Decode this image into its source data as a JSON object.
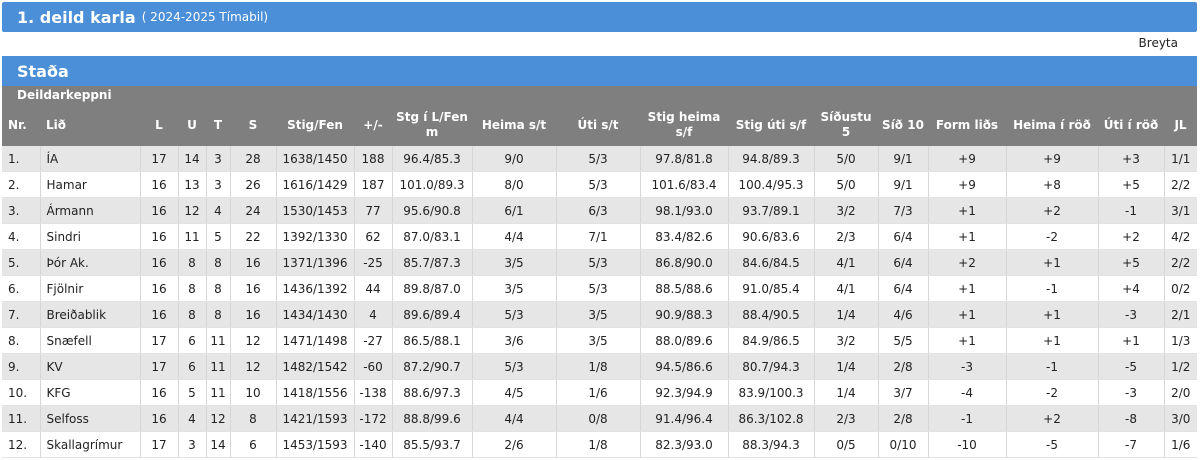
{
  "header": {
    "title": "1. deild karla",
    "subtitle": "( 2024-2025 Tímabil)"
  },
  "edit_label": "Breyta",
  "section_title": "Staða",
  "subheader": "Deildarkeppni",
  "columns": [
    "Nr.",
    "Lið",
    "L",
    "U",
    "T",
    "S",
    "Stig/Fen",
    "+/-",
    "Stg í L/Fen m",
    "Heima s/t",
    "Úti s/t",
    "Stig heima s/f",
    "Stig úti s/f",
    "Síðustu 5",
    "Síð 10",
    "Form liðs",
    "Heima í röð",
    "Úti í röð",
    "JL"
  ],
  "rows": [
    [
      "1.",
      "ÍA",
      "17",
      "14",
      "3",
      "28",
      "1638/1450",
      "188",
      "96.4/85.3",
      "9/0",
      "5/3",
      "97.8/81.8",
      "94.8/89.3",
      "5/0",
      "9/1",
      "+9",
      "+9",
      "+3",
      "1/1"
    ],
    [
      "2.",
      "Hamar",
      "16",
      "13",
      "3",
      "26",
      "1616/1429",
      "187",
      "101.0/89.3",
      "8/0",
      "5/3",
      "101.6/83.4",
      "100.4/95.3",
      "5/0",
      "9/1",
      "+9",
      "+8",
      "+5",
      "2/2"
    ],
    [
      "3.",
      "Ármann",
      "16",
      "12",
      "4",
      "24",
      "1530/1453",
      "77",
      "95.6/90.8",
      "6/1",
      "6/3",
      "98.1/93.0",
      "93.7/89.1",
      "3/2",
      "7/3",
      "+1",
      "+2",
      "-1",
      "3/1"
    ],
    [
      "4.",
      "Sindri",
      "16",
      "11",
      "5",
      "22",
      "1392/1330",
      "62",
      "87.0/83.1",
      "4/4",
      "7/1",
      "83.4/82.6",
      "90.6/83.6",
      "2/3",
      "6/4",
      "+1",
      "-2",
      "+2",
      "4/2"
    ],
    [
      "5.",
      "Þór Ak.",
      "16",
      "8",
      "8",
      "16",
      "1371/1396",
      "-25",
      "85.7/87.3",
      "3/5",
      "5/3",
      "86.8/90.0",
      "84.6/84.5",
      "4/1",
      "6/4",
      "+2",
      "+1",
      "+5",
      "2/2"
    ],
    [
      "6.",
      "Fjölnir",
      "16",
      "8",
      "8",
      "16",
      "1436/1392",
      "44",
      "89.8/87.0",
      "3/5",
      "5/3",
      "88.5/88.6",
      "91.0/85.4",
      "4/1",
      "6/4",
      "+1",
      "-1",
      "+4",
      "0/2"
    ],
    [
      "7.",
      "Breiðablik",
      "16",
      "8",
      "8",
      "16",
      "1434/1430",
      "4",
      "89.6/89.4",
      "5/3",
      "3/5",
      "90.9/88.3",
      "88.4/90.5",
      "1/4",
      "4/6",
      "+1",
      "+1",
      "-3",
      "2/1"
    ],
    [
      "8.",
      "Snæfell",
      "17",
      "6",
      "11",
      "12",
      "1471/1498",
      "-27",
      "86.5/88.1",
      "3/6",
      "3/5",
      "88.0/89.6",
      "84.9/86.5",
      "3/2",
      "5/5",
      "+1",
      "+1",
      "+1",
      "1/3"
    ],
    [
      "9.",
      "KV",
      "17",
      "6",
      "11",
      "12",
      "1482/1542",
      "-60",
      "87.2/90.7",
      "5/3",
      "1/8",
      "94.5/86.6",
      "80.7/94.3",
      "1/4",
      "2/8",
      "-3",
      "-1",
      "-5",
      "1/2"
    ],
    [
      "10.",
      "KFG",
      "16",
      "5",
      "11",
      "10",
      "1418/1556",
      "-138",
      "88.6/97.3",
      "4/5",
      "1/6",
      "92.3/94.9",
      "83.9/100.3",
      "1/4",
      "3/7",
      "-4",
      "-2",
      "-3",
      "2/0"
    ],
    [
      "11.",
      "Selfoss",
      "16",
      "4",
      "12",
      "8",
      "1421/1593",
      "-172",
      "88.8/99.6",
      "4/4",
      "0/8",
      "91.4/96.4",
      "86.3/102.8",
      "2/3",
      "2/8",
      "-1",
      "+2",
      "-8",
      "3/0"
    ],
    [
      "12.",
      "Skallagrímur",
      "17",
      "3",
      "14",
      "6",
      "1453/1593",
      "-140",
      "85.5/93.7",
      "2/6",
      "1/8",
      "82.3/93.0",
      "88.3/94.3",
      "0/5",
      "0/10",
      "-10",
      "-5",
      "-7",
      "1/6"
    ]
  ]
}
